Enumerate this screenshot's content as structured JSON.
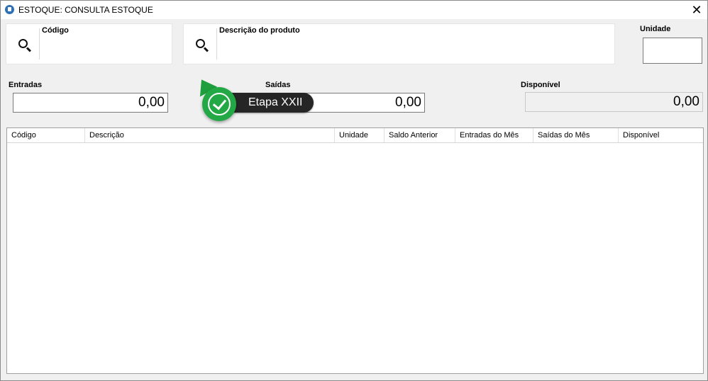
{
  "window": {
    "title": "ESTOQUE: CONSULTA ESTOQUE",
    "close_symbol": "✕"
  },
  "search": {
    "codigo": {
      "label": "Código",
      "value": ""
    },
    "descricao": {
      "label": "Descrição do produto",
      "value": ""
    },
    "unidade": {
      "label": "Unidade",
      "value": ""
    }
  },
  "totals": {
    "entradas": {
      "label": "Entradas",
      "value": "0,00"
    },
    "saidas": {
      "label": "Saídas",
      "value": "0,00"
    },
    "disponivel": {
      "label": "Disponível",
      "value": "0,00"
    }
  },
  "grid": {
    "columns": [
      "Código",
      "Descrição",
      "Unidade",
      "Saldo Anterior",
      "Entradas do Mês",
      "Saídas do Mês",
      "Disponível"
    ],
    "rows": []
  },
  "badge": {
    "label": "Etapa XXII",
    "color": "#23a846"
  }
}
